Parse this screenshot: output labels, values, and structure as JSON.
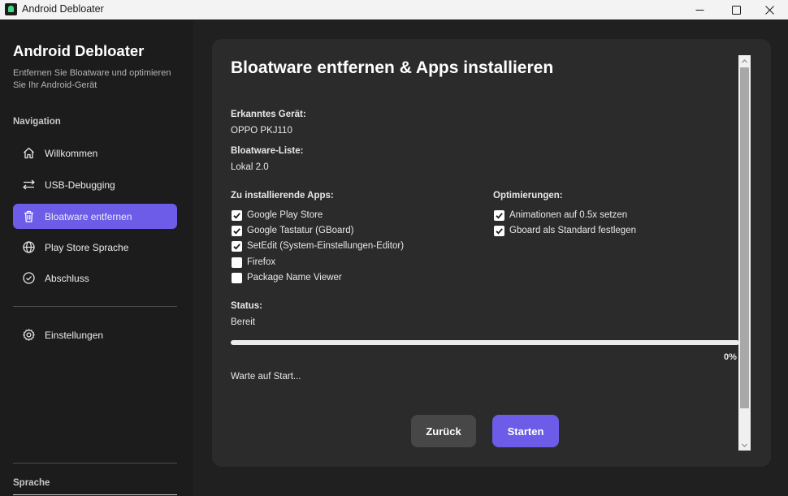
{
  "window": {
    "title": "Android Debloater"
  },
  "sidebar": {
    "app_name": "Android Debloater",
    "subtitle": "Entfernen Sie Bloatware und optimieren Sie Ihr Android-Gerät",
    "nav_heading": "Navigation",
    "items": [
      {
        "label": "Willkommen",
        "icon": "home-icon",
        "active": false
      },
      {
        "label": "USB-Debugging",
        "icon": "arrows-swap-icon",
        "active": false
      },
      {
        "label": "Bloatware entfernen",
        "icon": "trash-icon",
        "active": true
      },
      {
        "label": "Play Store Sprache",
        "icon": "globe-icon",
        "active": false
      },
      {
        "label": "Abschluss",
        "icon": "check-circle-icon",
        "active": false
      }
    ],
    "settings_label": "Einstellungen",
    "language_heading": "Sprache"
  },
  "main": {
    "title": "Bloatware entfernen & Apps installieren",
    "device_label": "Erkanntes Gerät:",
    "device_value": "OPPO PKJ110",
    "list_label": "Bloatware-Liste:",
    "list_value": "Lokal 2.0",
    "apps_heading": "Zu installierende Apps:",
    "apps": [
      {
        "label": "Google Play Store",
        "checked": true
      },
      {
        "label": "Google Tastatur (GBoard)",
        "checked": true
      },
      {
        "label": "SetEdit (System-Einstellungen-Editor)",
        "checked": true
      },
      {
        "label": "Firefox",
        "checked": false
      },
      {
        "label": "Package Name Viewer",
        "checked": false
      }
    ],
    "opt_heading": "Optimierungen:",
    "optimizations": [
      {
        "label": "Animationen auf 0.5x setzen",
        "checked": true
      },
      {
        "label": "Gboard als Standard festlegen",
        "checked": true
      }
    ],
    "status_label": "Status:",
    "status_value": "Bereit",
    "progress_percent": 0,
    "progress_text": "0%",
    "log_text": "Warte auf Start...",
    "back_button": "Zurück",
    "start_button": "Starten"
  },
  "colors": {
    "accent": "#6c5ce7",
    "sidebar_bg": "#1c1c1c",
    "panel_bg": "#2b2b2b"
  }
}
